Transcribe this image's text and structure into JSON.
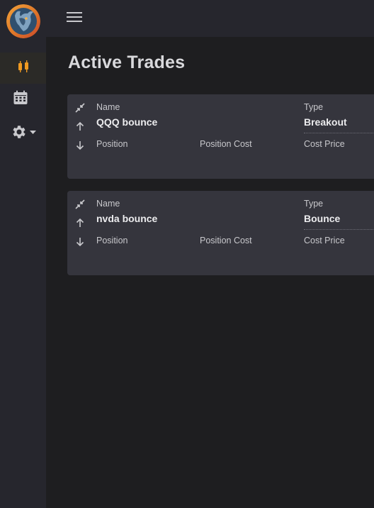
{
  "app": {
    "logo_icon": "bull-logo-icon"
  },
  "sidebar": {
    "items": [
      {
        "icon": "candlestick-icon",
        "active": true,
        "color": "#f09a21"
      },
      {
        "icon": "calendar-icon",
        "active": false,
        "color": "#c9c9cd"
      },
      {
        "icon": "gear-icon",
        "active": false,
        "color": "#c9c9cd",
        "has_dropdown": true
      }
    ]
  },
  "topbar": {
    "menu_icon": "hamburger-icon"
  },
  "page": {
    "title": "Active Trades"
  },
  "trades": [
    {
      "name_label": "Name",
      "name": "QQQ bounce",
      "type_label": "Type",
      "type": "Breakout",
      "position_label": "Position",
      "position_cost_label": "Position Cost",
      "cost_price_label": "Cost Price"
    },
    {
      "name_label": "Name",
      "name": "nvda bounce",
      "type_label": "Type",
      "type": "Bounce",
      "position_label": "Position",
      "position_cost_label": "Position Cost",
      "cost_price_label": "Cost Price"
    }
  ],
  "colors": {
    "accent": "#f09a21",
    "background": "#1e1e20",
    "card": "#35353d",
    "sidebar": "#26262d"
  }
}
